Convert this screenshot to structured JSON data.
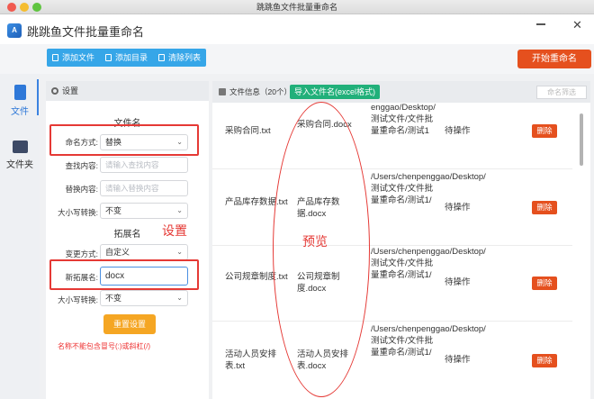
{
  "window": {
    "title": "跳跳鱼文件批量重命名"
  },
  "app": {
    "logo": "A",
    "title": "跳跳鱼文件批量重命名",
    "close": "✕"
  },
  "toolbar": {
    "add_file": "添加文件",
    "add_dir": "添加目录",
    "clear_list": "清除列表",
    "start": "开始重命名"
  },
  "sidebar": {
    "items": [
      {
        "label": "文件"
      },
      {
        "label": "文件夹"
      }
    ]
  },
  "settings": {
    "header": "设置",
    "filename_section": "文件名",
    "naming_mode_label": "命名方式:",
    "naming_mode_value": "替换",
    "find_label": "查找内容:",
    "find_placeholder": "请输入查找内容",
    "replace_label": "替换内容:",
    "replace_placeholder": "请输入替换内容",
    "case_label": "大小写转换:",
    "case_value": "不变",
    "ext_section": "拓展名",
    "change_mode_label": "变更方式:",
    "change_mode_value": "自定义",
    "new_ext_label": "新拓展名:",
    "new_ext_value": "docx",
    "ext_case_label": "大小写转换:",
    "ext_case_value": "不变",
    "reset": "重置设置",
    "warning": "名称不能包含冒号(:)或斜杠(/)"
  },
  "annotations": {
    "settings": "设置",
    "preview": "预览"
  },
  "file_panel": {
    "title": "文件信息（20个）",
    "import_button": "导入文件名(excel格式)",
    "search_placeholder": "命名筛选",
    "rows": [
      {
        "name": "采购合同.txt",
        "new_name": "采购合同.docx",
        "path": "enggao/Desktop/测试文件/文件批量重命名/测试1",
        "status": "待操作",
        "action": "删除"
      },
      {
        "name": "产品库存数据.txt",
        "new_name": "产品库存数据.docx",
        "path": "/Users/chenpenggao/Desktop/测试文件/文件批量重命名/测试1/",
        "status": "待操作",
        "action": "删除"
      },
      {
        "name": "公司规章制度.txt",
        "new_name": "公司规章制度.docx",
        "path": "/Users/chenpenggao/Desktop/测试文件/文件批量重命名/测试1/",
        "status": "待操作",
        "action": "删除"
      },
      {
        "name": "活动人员安排表.txt",
        "new_name": "活动人员安排表.docx",
        "path": "/Users/chenpenggao/Desktop/测试文件/文件批量重命名/测试1/",
        "status": "待操作",
        "action": "删除"
      }
    ]
  }
}
